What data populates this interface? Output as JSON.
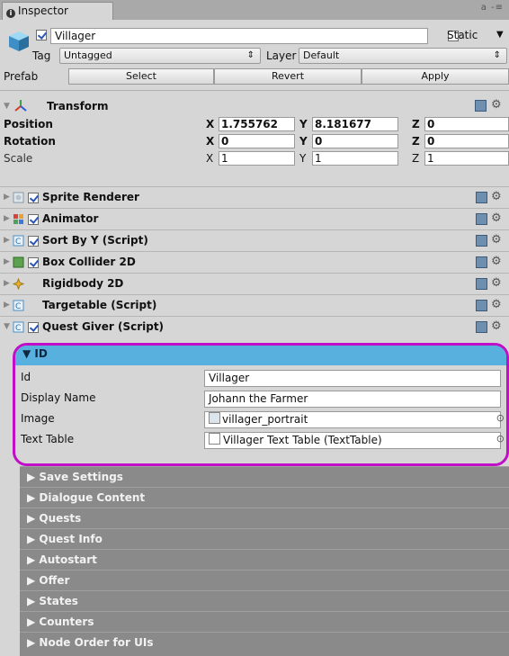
{
  "window": {
    "tab_title": "Inspector",
    "tab_icon": "info-icon",
    "menu_glyphs": "a -≡"
  },
  "object": {
    "name": "Villager",
    "static_label": "Static",
    "tag_label": "Tag",
    "tag_value": "Untagged",
    "layer_label": "Layer",
    "layer_value": "Default",
    "prefab_label": "Prefab",
    "prefab_buttons": [
      "Select",
      "Revert",
      "Apply"
    ]
  },
  "transform": {
    "title": "Transform",
    "rows": [
      {
        "label": "Position",
        "x": "1.755762",
        "y": "8.181677",
        "z": "0"
      },
      {
        "label": "Rotation",
        "x": "0",
        "y": "0",
        "z": "0"
      },
      {
        "label": "Scale",
        "x": "1",
        "y": "1",
        "z": "1"
      }
    ],
    "axis": {
      "x": "X",
      "y": "Y",
      "z": "Z"
    }
  },
  "components": [
    {
      "name": "Sprite Renderer",
      "checked": true,
      "icon": "sprite-renderer-icon"
    },
    {
      "name": "Animator",
      "checked": true,
      "icon": "animator-icon"
    },
    {
      "name": "Sort By Y (Script)",
      "checked": true,
      "icon": "script-icon"
    },
    {
      "name": "Box Collider 2D",
      "checked": true,
      "icon": "box-collider-icon"
    },
    {
      "name": "Rigidbody 2D",
      "checked": false,
      "icon": "rigidbody-icon"
    },
    {
      "name": "Targetable (Script)",
      "checked": false,
      "icon": "script-icon"
    },
    {
      "name": "Quest Giver (Script)",
      "checked": true,
      "icon": "script-icon"
    }
  ],
  "id_section": {
    "title": "ID",
    "fields": [
      {
        "label": "Id",
        "value": "Villager"
      },
      {
        "label": "Display Name",
        "value": "Johann the Farmer"
      },
      {
        "label": "Image",
        "value": "villager_portrait"
      },
      {
        "label": "Text Table",
        "value": "Villager Text Table (TextTable)"
      }
    ]
  },
  "sections": [
    "Save Settings",
    "Dialogue Content",
    "Quests",
    "Quest Info",
    "Autostart",
    "Offer",
    "States",
    "Counters",
    "Node Order for UIs"
  ],
  "colors": {
    "highlight": "#c00fc6",
    "id_header": "#58b0df",
    "section_bg": "#8a8a8a"
  }
}
